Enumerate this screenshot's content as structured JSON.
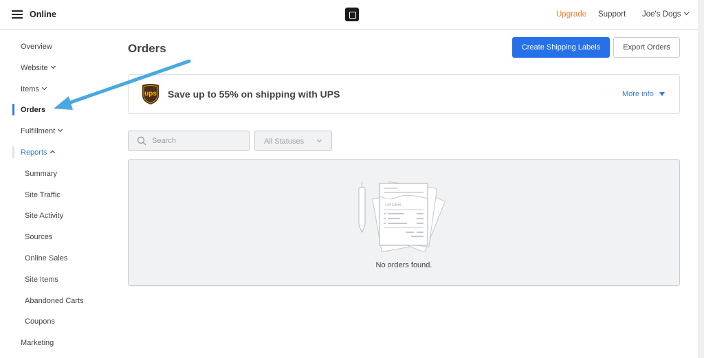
{
  "header": {
    "app_title": "Online",
    "logo_icon": "square-logo-icon",
    "links": {
      "upgrade": "Upgrade",
      "support": "Support",
      "account": "Joe's Dogs"
    },
    "upgrade_color": "#ef7d35"
  },
  "sidebar": {
    "items": [
      {
        "label": "Overview"
      },
      {
        "label": "Website"
      },
      {
        "label": "Items"
      },
      {
        "label": "Orders"
      },
      {
        "label": "Fulfillment"
      },
      {
        "label": "Reports"
      },
      {
        "label": "Summary"
      },
      {
        "label": "Site Traffic"
      },
      {
        "label": "Site Activity"
      },
      {
        "label": "Sources"
      },
      {
        "label": "Online Sales"
      },
      {
        "label": "Site Items"
      },
      {
        "label": "Abandoned Carts"
      },
      {
        "label": "Coupons"
      },
      {
        "label": "Marketing"
      }
    ],
    "active_item": "Orders",
    "accent_color": "#3a7bd5"
  },
  "main": {
    "title": "Orders",
    "buttons": {
      "primary": "Create Shipping Labels",
      "secondary": "Export Orders"
    },
    "primary_color": "#2671e8",
    "banner": {
      "logo_text": "ups",
      "text": "Save up to 55% on shipping with UPS",
      "more_info": "More info"
    },
    "filters": {
      "search_placeholder": "Search",
      "status": "All Statuses"
    },
    "empty_state": {
      "illustration_label": "ORDER",
      "message": "No orders found."
    }
  },
  "annotation": {
    "arrow_color": "#4aa8e0",
    "points_to": "Orders"
  }
}
